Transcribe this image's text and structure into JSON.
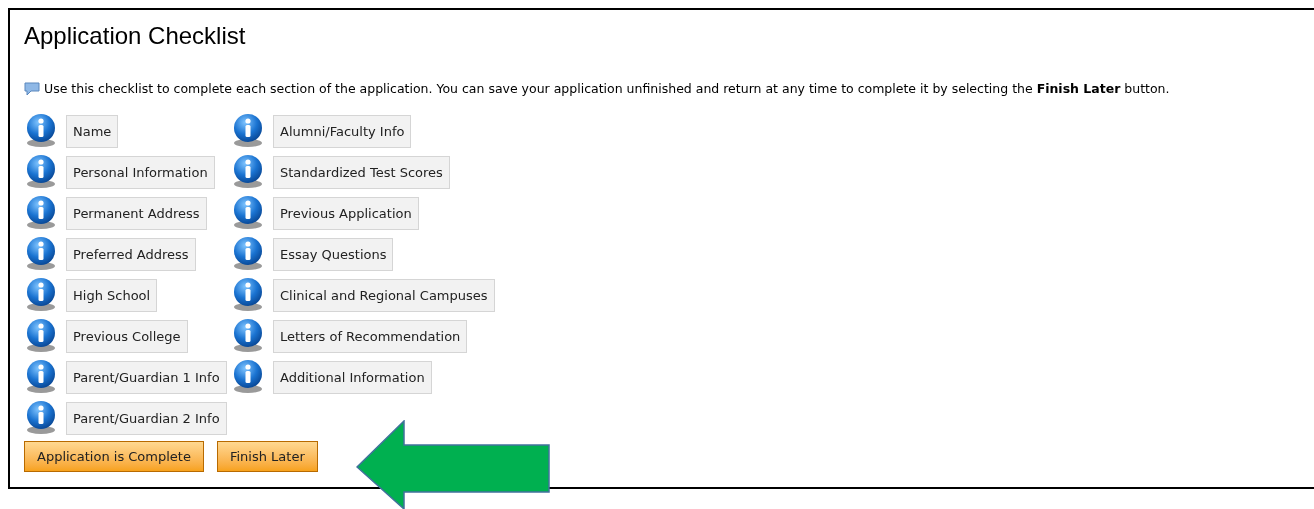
{
  "title": "Application Checklist",
  "instructions": "Use this checklist to complete each section of the application. You can save your application unfinished and return at any time to complete it by selecting the **Finish Later** button.",
  "columns": [
    [
      "Name",
      "Personal Information",
      "Permanent Address",
      "Preferred Address",
      "High School",
      "Previous College",
      "Parent/Guardian 1 Info",
      "Parent/Guardian 2 Info"
    ],
    [
      "Alumni/Faculty Info",
      "Standardized Test Scores",
      "Previous Application",
      "Essay Questions",
      "Clinical and Regional Campuses",
      "Letters of Recommendation",
      "Additional Information"
    ]
  ],
  "buttons": [
    "Application is Complete",
    "Finish Later"
  ]
}
